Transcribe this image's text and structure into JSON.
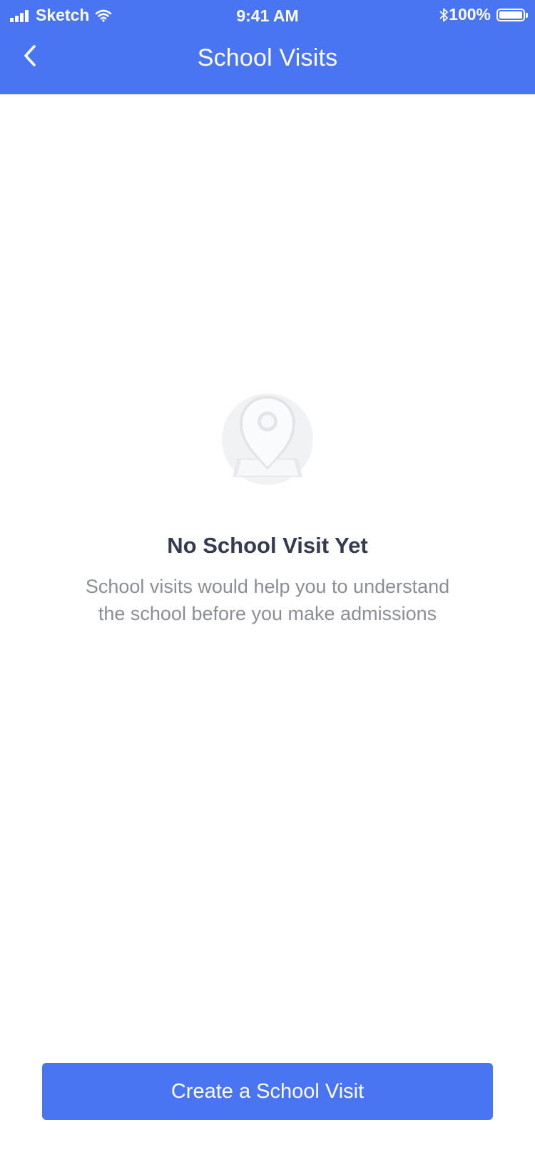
{
  "status_bar": {
    "carrier": "Sketch",
    "time": "9:41 AM",
    "battery_percent": "100%",
    "icons": [
      "signal-icon",
      "wifi-icon",
      "bluetooth-icon",
      "battery-icon"
    ]
  },
  "nav": {
    "title": "School Visits",
    "back_icon": "chevron-left-icon"
  },
  "empty_state": {
    "icon": "map-pin-icon",
    "title": "No School Visit Yet",
    "description": "School visits would help you to understand the school before you make admissions"
  },
  "cta": {
    "label": "Create a School Visit"
  },
  "colors": {
    "brand": "#4a75f2",
    "title_text": "#343a4f",
    "body_text": "#8b8e97"
  }
}
